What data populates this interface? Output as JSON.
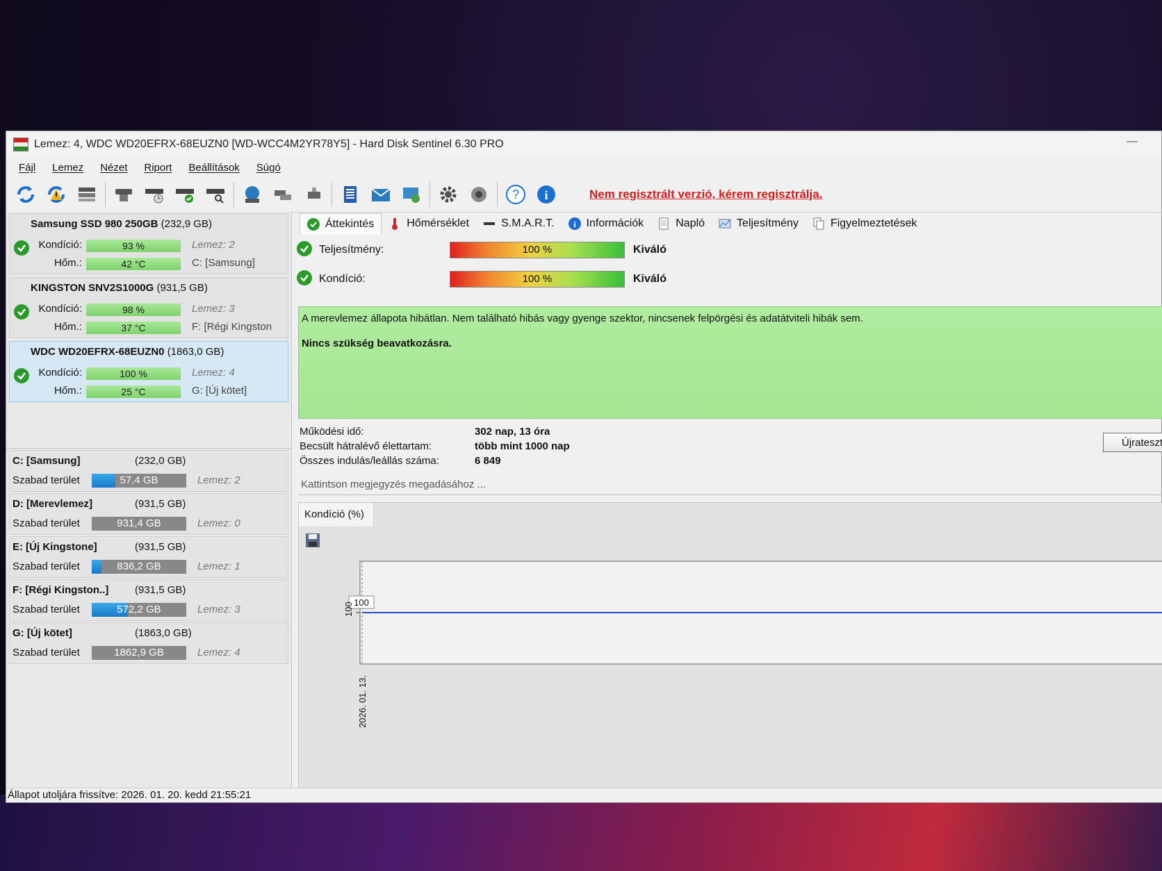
{
  "window": {
    "title": "Lemez: 4, WDC WD20EFRX-68EUZN0 [WD-WCC4M2YR78Y5]  -  Hard Disk Sentinel 6.30 PRO"
  },
  "menu": [
    "Fájl",
    "Lemez",
    "Nézet",
    "Riport",
    "Beállítások",
    "Súgó"
  ],
  "toolbar": {
    "register_link": "Nem regisztrált verzió, kérem regisztrálja."
  },
  "disks": [
    {
      "name": "Samsung SSD 980 250GB",
      "size": "(232,9 GB)",
      "cond_label": "Kondíció:",
      "cond": "93 %",
      "temp_label": "Hőm.:",
      "temp": "42 °C",
      "disk": "Lemez: 2",
      "vol": "C: [Samsung]"
    },
    {
      "name": "KINGSTON SNV2S1000G",
      "size": "(931,5 GB)",
      "cond_label": "Kondíció:",
      "cond": "98 %",
      "temp_label": "Hőm.:",
      "temp": "37 °C",
      "disk": "Lemez: 3",
      "vol": "F: [Régi Kingston"
    },
    {
      "name": "WDC WD20EFRX-68EUZN0",
      "size": "(1863,0 GB)",
      "cond_label": "Kondíció:",
      "cond": "100 %",
      "temp_label": "Hőm.:",
      "temp": "25 °C",
      "disk": "Lemez: 4",
      "vol": "G: [Új kötet]"
    }
  ],
  "volumes": [
    {
      "name": "C: [Samsung]",
      "size": "(232,0 GB)",
      "free_label": "Szabad terület",
      "free": "57,4 GB",
      "fill": 0.25,
      "disk": "Lemez: 2"
    },
    {
      "name": "D: [Merevlemez]",
      "size": "(931,5 GB)",
      "free_label": "Szabad terület",
      "free": "931,4 GB",
      "fill": 0.0,
      "disk": "Lemez: 0"
    },
    {
      "name": "E: [Új Kingstone]",
      "size": "(931,5 GB)",
      "free_label": "Szabad terület",
      "free": "836,2 GB",
      "fill": 0.1,
      "disk": "Lemez: 1"
    },
    {
      "name": "F: [Régi Kingston..]",
      "size": "(931,5 GB)",
      "free_label": "Szabad terület",
      "free": "572,2 GB",
      "fill": 0.38,
      "disk": "Lemez: 3"
    },
    {
      "name": "G: [Új kötet]",
      "size": "(1863,0 GB)",
      "free_label": "Szabad terület",
      "free": "1862,9 GB",
      "fill": 0.0,
      "disk": "Lemez: 4"
    }
  ],
  "tabs": [
    "Áttekintés",
    "Hőmérséklet",
    "S.M.A.R.T.",
    "Információk",
    "Napló",
    "Teljesítmény",
    "Figyelmeztetések"
  ],
  "overview": {
    "perf_label": "Teljesítmény:",
    "perf_value": "100 %",
    "perf_rating": "Kiváló",
    "cond_label": "Kondíció:",
    "cond_value": "100 %",
    "cond_rating": "Kiváló",
    "status_text": "A merevlemez állapota hibátlan. Nem található hibás vagy gyenge szektor, nincsenek felpörgési és adatátviteli hibák sem.",
    "status_action": "Nincs szükség beavatkozásra.",
    "uptime_label": "Működési idő:",
    "uptime_value": "302 nap, 13 óra",
    "remaining_label": "Becsült hátralévő élettartam:",
    "remaining_value": "több mint 1000 nap",
    "starts_label": "Összes indulás/leállás száma:",
    "starts_value": "6 849",
    "retest_button": "Újrateszte",
    "note_placeholder": "Kattintson megjegyzés megadásához ..."
  },
  "chart_data": {
    "type": "line",
    "title": "Kondíció  (%)",
    "x": [
      "2026. 01. 13."
    ],
    "series": [
      {
        "values": [
          100
        ]
      }
    ],
    "ylim": [
      100,
      100
    ],
    "grid": false,
    "data_label": "100",
    "ytick": "100"
  },
  "statusbar": {
    "text": "Állapot utoljára frissítve: 2026. 01. 20. kedd 21:55:21"
  }
}
